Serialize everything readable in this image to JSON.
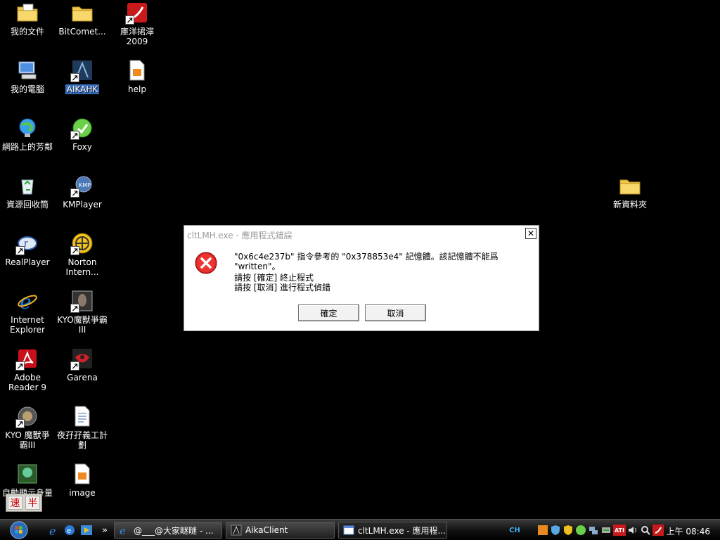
{
  "desktop": {
    "icons": [
      {
        "label": "我的文件"
      },
      {
        "label": "BitComet..."
      },
      {
        "label": "庫洋捃濘\n2009"
      },
      {
        "label": "我的電腦"
      },
      {
        "label": "AIKAHK"
      },
      {
        "label": "help"
      },
      {
        "label": "網路上的芳鄰"
      },
      {
        "label": "Foxy"
      },
      {
        "label": "資源回收筒"
      },
      {
        "label": "KMPlayer"
      },
      {
        "label": "RealPlayer"
      },
      {
        "label": "Norton\nIntern..."
      },
      {
        "label": "Internet\nExplorer"
      },
      {
        "label": "KYO魔獸爭霸\nIII"
      },
      {
        "label": "Adobe\nReader 9"
      },
      {
        "label": "Garena"
      },
      {
        "label": "KYO 魔獸爭\n霸III"
      },
      {
        "label": "夜孖孖義工計\n劃"
      },
      {
        "label": "自動顯示身量"
      },
      {
        "label": "image"
      },
      {
        "label": "新資料夾"
      }
    ]
  },
  "dialog": {
    "title": "cltLMH.exe - 應用程式錯誤",
    "close_glyph": "✕",
    "message": "\"0x6c4e237b\" 指令參考的 \"0x378853e4\" 記憶體。該記憶體不能爲 \"written\"。",
    "line1": "請按 [確定] 終止程式",
    "line2": "請按 [取消] 進行程式偵錯",
    "ok_label": "確定",
    "cancel_label": "取消"
  },
  "ime": {
    "left": "速",
    "right": "半"
  },
  "taskbar": {
    "chevron": "»",
    "buttons": [
      {
        "label": "@___@大家瞇瞇 - ..."
      },
      {
        "label": "AikaClient"
      },
      {
        "label": "cltLMH.exe - 應用程..."
      }
    ],
    "lang": "CH",
    "ati": "ATI",
    "clock": "上午 08:46"
  },
  "colors": {
    "accent": "#3a6fc4",
    "error": "#d42020"
  }
}
